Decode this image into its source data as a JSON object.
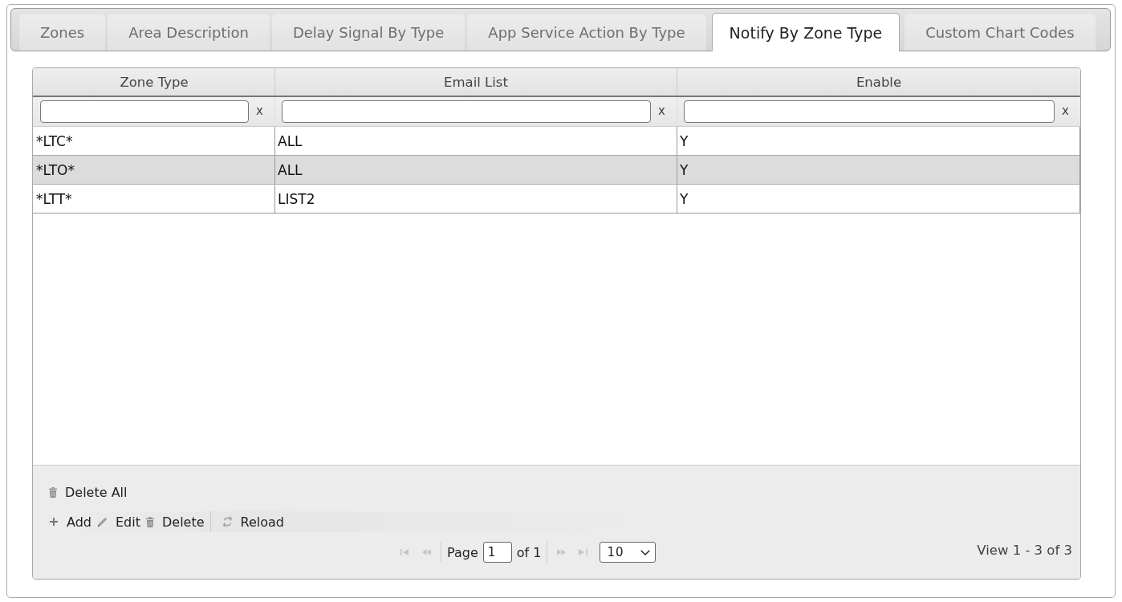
{
  "tabs": [
    {
      "label": "Zones",
      "selected": false
    },
    {
      "label": "Area Description",
      "selected": false
    },
    {
      "label": "Delay Signal By Type",
      "selected": false
    },
    {
      "label": "App Service Action By Type",
      "selected": false
    },
    {
      "label": "Notify By Zone Type",
      "selected": true
    },
    {
      "label": "Custom Chart Codes",
      "selected": false
    }
  ],
  "grid": {
    "columns": [
      "Zone Type",
      "Email List",
      "Enable"
    ],
    "filters": [
      {
        "clear": "x"
      },
      {
        "clear": "x"
      },
      {
        "clear": "x"
      }
    ],
    "rows": [
      {
        "cells": [
          "*LTC*",
          "ALL",
          "Y"
        ],
        "selected": false
      },
      {
        "cells": [
          "*LTO*",
          "ALL",
          "Y"
        ],
        "selected": true
      },
      {
        "cells": [
          "*LTT*",
          "LIST2",
          "Y"
        ],
        "selected": false
      }
    ]
  },
  "toolbar_top": [
    {
      "kind": "delete",
      "label": "Delete All"
    }
  ],
  "toolbar_bottom": [
    [
      {
        "kind": "add",
        "label": "Add"
      },
      {
        "kind": "edit",
        "label": "Edit"
      },
      {
        "kind": "delete",
        "label": "Delete"
      }
    ],
    [
      {
        "kind": "reload",
        "label": "Reload"
      }
    ]
  ],
  "pager": {
    "nav_before": [
      {
        "kind": "first",
        "disabled": true
      },
      {
        "kind": "prev",
        "disabled": true
      }
    ],
    "page_label": "Page",
    "page": "1",
    "of_label": "of 1",
    "nav_after": [
      {
        "kind": "next",
        "disabled": true
      },
      {
        "kind": "last",
        "disabled": true
      }
    ],
    "page_size": "10",
    "view": "View 1 - 3 of 3"
  }
}
